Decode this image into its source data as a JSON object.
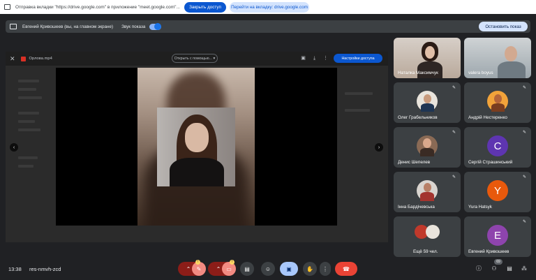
{
  "notification": {
    "message": "Отправка вкладки \"https://drive.google.com\" в приложение \"meet.google.com\"...",
    "primary_button": "Закрыть доступ",
    "secondary_button": "Перейти на вкладку: drive.google.com"
  },
  "presenting": {
    "presenter": "Евгений Кривошеев (вы, на главном экране)",
    "sound_label": "Звук показа",
    "sound_on": true,
    "stop_button": "Остановить показ"
  },
  "shared_tab": {
    "file_name": "Орлова.mp4",
    "open_with": "Открыть с помощью...",
    "access_button": "Настройки доступа"
  },
  "participants": [
    {
      "name": "Наталка Максимчук",
      "type": "camera"
    },
    {
      "name": "valera boyus",
      "type": "camera"
    },
    {
      "name": "Олег Грабельников",
      "type": "photo",
      "muted": true
    },
    {
      "name": "Андрій Нестеренко",
      "type": "photo",
      "muted": true
    },
    {
      "name": "Денис Шепелев",
      "type": "photo",
      "muted": true
    },
    {
      "name": "Сергій Страшинський",
      "type": "letter",
      "letter": "С",
      "color": "#5e35b1",
      "muted": true
    },
    {
      "name": "Інна Бардічевська",
      "type": "photo",
      "muted": true
    },
    {
      "name": "Yura Hatsyk",
      "type": "letter",
      "letter": "Y",
      "color": "#e8590c",
      "muted": true
    },
    {
      "name": "Ещё 59 чел.",
      "type": "more"
    },
    {
      "name": "Евгений Кривошеев",
      "type": "letter",
      "letter": "E",
      "color": "#8e44ad",
      "muted": true
    }
  ],
  "controls": {
    "time": "13:38",
    "meeting_code": "res-nmvh-zcd",
    "people_count": "69",
    "end_call_color": "#ea4335"
  }
}
